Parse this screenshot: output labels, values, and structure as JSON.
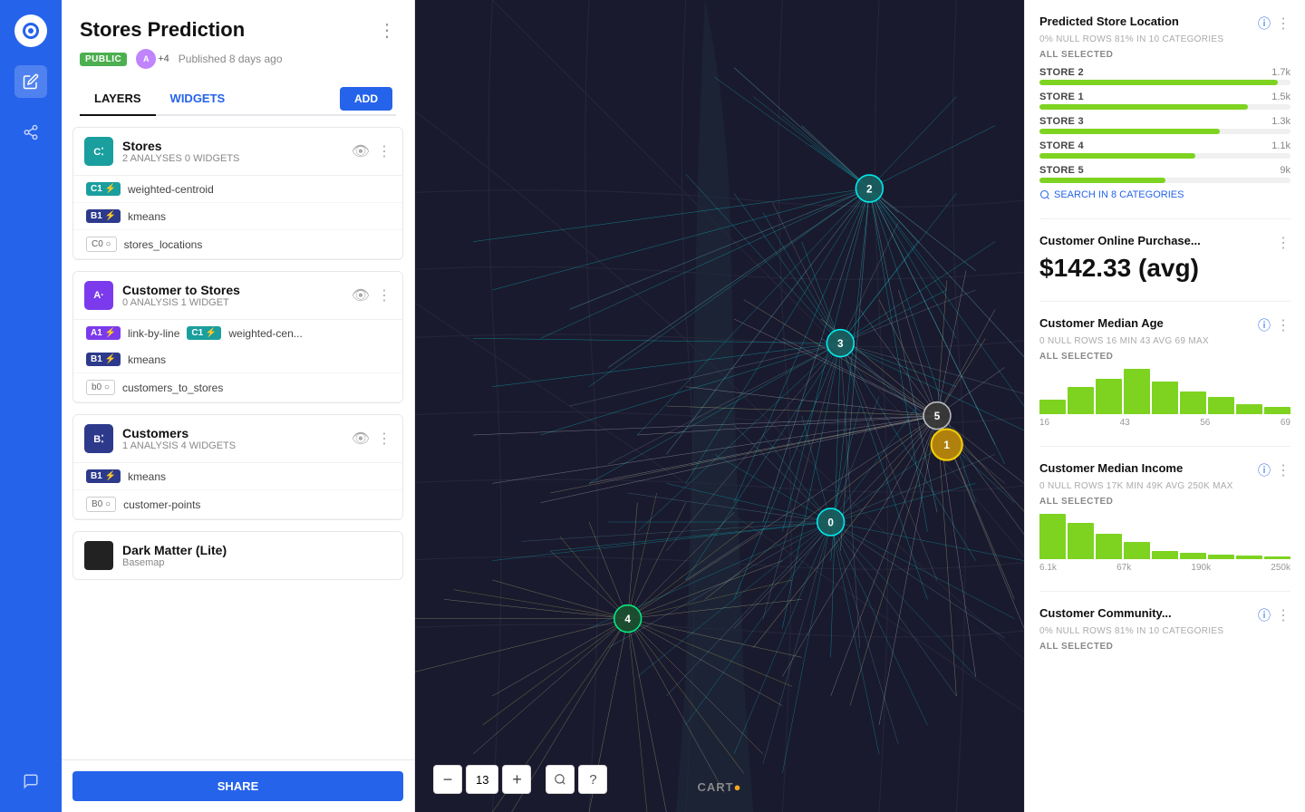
{
  "nav": {
    "logo_text": "C",
    "icons": [
      "✏️",
      "⚡",
      "💬"
    ]
  },
  "header": {
    "title": "Stores Prediction",
    "menu_icon": "⋮",
    "badge": "PUBLIC",
    "avatars": [
      "+4"
    ],
    "publish_time": "Published 8 days ago"
  },
  "tabs": {
    "layers_label": "LAYERS",
    "widgets_label": "WIDGETS",
    "add_label": "ADD"
  },
  "layers": [
    {
      "id": "stores",
      "icon_text": "C⁚",
      "icon_class": "teal",
      "title": "Stores",
      "subtitle": "2 ANALYSES   0 WIDGETS",
      "analyses": [
        {
          "badge": "C1",
          "badge_class": "badge-c1",
          "name": "weighted-centroid",
          "type": "single"
        },
        {
          "badge": "B1",
          "badge_class": "badge-b1",
          "name": "kmeans",
          "type": "single"
        },
        {
          "badge": "C0",
          "badge_class": "badge-c0-inner",
          "name": "stores_locations",
          "type": "single"
        }
      ]
    },
    {
      "id": "customer-to-stores",
      "icon_text": "A·",
      "icon_class": "purple",
      "title": "Customer to Stores",
      "subtitle": "0 ANALYSIS   1 WIDGET",
      "analyses": [
        {
          "badge": "A1",
          "badge_class": "badge-a1",
          "name": "link-by-line",
          "badge2": "C1",
          "badge_class2": "badge-c1",
          "name2": "weighted-cen...",
          "type": "double"
        },
        {
          "badge": "B1",
          "badge_class": "badge-b1",
          "name": "kmeans",
          "type": "single"
        },
        {
          "badge": "b0",
          "badge_class": "badge-b0-inner",
          "name": "customers_to_stores",
          "type": "single"
        }
      ]
    },
    {
      "id": "customers",
      "icon_text": "B⁚",
      "icon_class": "dark-blue",
      "title": "Customers",
      "subtitle": "1 ANALYSIS   4 WIDGETS",
      "analyses": [
        {
          "badge": "B1",
          "badge_class": "badge-b1",
          "name": "kmeans",
          "type": "single"
        },
        {
          "badge": "B0",
          "badge_class": "badge-b0-inner",
          "name": "customer-points",
          "type": "single"
        }
      ]
    }
  ],
  "basemap": {
    "title": "Dark Matter (Lite)",
    "subtitle": "Basemap"
  },
  "share_label": "SHARE",
  "map": {
    "zoom": "13",
    "carto_label": "CART●"
  },
  "right_panel": {
    "widgets": [
      {
        "id": "predicted-store-location",
        "title": "Predicted Store Location",
        "type": "category",
        "stats": "0% NULL ROWS   81% IN 10 CATEGORIES",
        "selected": "ALL SELECTED",
        "search_label": "SEARCH IN 8 CATEGORIES",
        "categories": [
          {
            "label": "STORE 2",
            "value": "1.7k",
            "pct": 95
          },
          {
            "label": "STORE 1",
            "value": "1.5k",
            "pct": 83
          },
          {
            "label": "STORE 3",
            "value": "1.3k",
            "pct": 72
          },
          {
            "label": "STORE 4",
            "value": "1.1k",
            "pct": 62
          },
          {
            "label": "STORE 5",
            "value": "9k",
            "pct": 50
          }
        ]
      },
      {
        "id": "customer-online-purchase",
        "title": "Customer Online Purchase...",
        "type": "value",
        "big_value": "$142.33 (avg)"
      },
      {
        "id": "customer-median-age",
        "title": "Customer Median Age",
        "type": "histogram",
        "stats": "0 NULL ROWS   16 MIN   43 AVG   69 MAX",
        "selected": "ALL SELECTED",
        "hist_bars": [
          30,
          55,
          70,
          90,
          65,
          45,
          35,
          20,
          15
        ],
        "hist_labels": [
          "16",
          "43",
          "56",
          "69"
        ]
      },
      {
        "id": "customer-median-income",
        "title": "Customer Median Income",
        "type": "histogram",
        "stats": "0 NULL ROWS   17K MIN   49K AVG   250K MAX",
        "selected": "ALL SELECTED",
        "hist_bars": [
          80,
          65,
          45,
          30,
          15,
          12,
          8,
          6,
          5
        ],
        "hist_labels": [
          "6.1k",
          "67k",
          "190k",
          "250k"
        ]
      },
      {
        "id": "customer-community",
        "title": "Customer Community...",
        "type": "category",
        "stats": "0% NULL ROWS   81% IN 10 CATEGORIES",
        "selected": "ALL SELECTED"
      }
    ]
  }
}
